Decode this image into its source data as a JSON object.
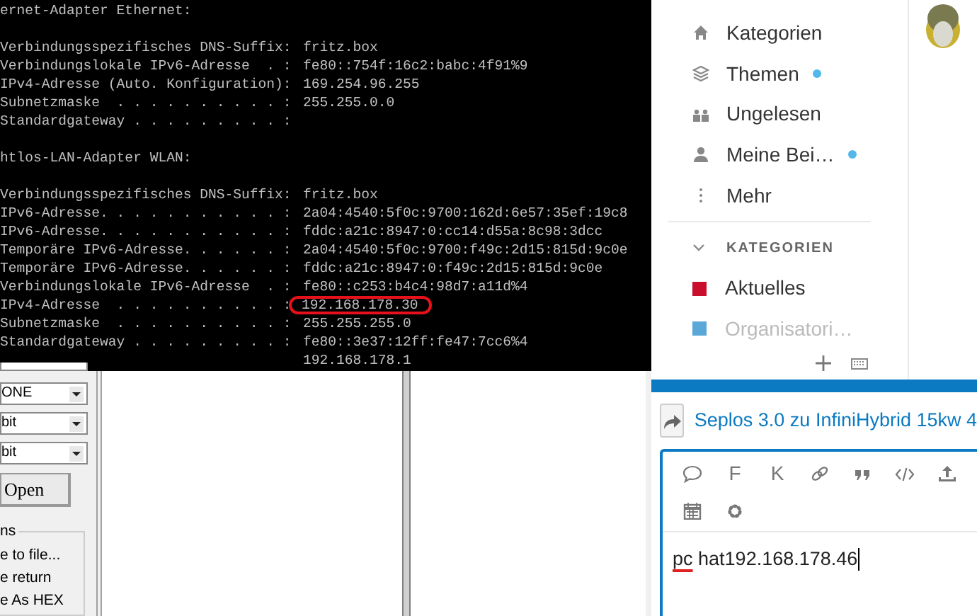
{
  "terminal": {
    "adapters": [
      {
        "title": "ernet-Adapter Ethernet:",
        "entries": [
          {
            "label": "Verbindungsspezifisches DNS-Suffix:",
            "value": "fritz.box",
            "highlighted": false
          },
          {
            "label": "Verbindungslokale IPv6-Adresse  . :",
            "value": "fe80::754f:16c2:babc:4f91%9",
            "highlighted": false
          },
          {
            "label": "IPv4-Adresse (Auto. Konfiguration):",
            "value": "169.254.96.255",
            "highlighted": false
          },
          {
            "label": "Subnetzmaske  . . . . . . . . . . :",
            "value": "255.255.0.0",
            "highlighted": false
          },
          {
            "label": "Standardgateway . . . . . . . . . :"
          }
        ]
      },
      {
        "title": "htlos-LAN-Adapter WLAN:",
        "entries": [
          {
            "label": "Verbindungsspezifisches DNS-Suffix:",
            "value": "fritz.box",
            "highlighted": false
          },
          {
            "label": "IPv6-Adresse. . . . . . . . . . . :",
            "value": "2a04:4540:5f0c:9700:162d:6e57:35ef:19c8",
            "highlighted": false
          },
          {
            "label": "IPv6-Adresse. . . . . . . . . . . :",
            "value": "fddc:a21c:8947:0:cc14:d55a:8c98:3dcc",
            "highlighted": false
          },
          {
            "label": "Temporäre IPv6-Adresse. . . . . . :",
            "value": "2a04:4540:5f0c:9700:f49c:2d15:815d:9c0e",
            "highlighted": false
          },
          {
            "label": "Temporäre IPv6-Adresse. . . . . . :",
            "value": "fddc:a21c:8947:0:f49c:2d15:815d:9c0e",
            "highlighted": false
          },
          {
            "label": "Verbindungslokale IPv6-Adresse  . :",
            "value": "fe80::c253:b4c4:98d7:a11d%4",
            "highlighted": false
          },
          {
            "label": "IPv4-Adresse  . . . . . . . . . . :",
            "value": "192.168.178.30",
            "highlighted": true
          },
          {
            "label": "Subnetzmaske  . . . . . . . . . . :",
            "value": "255.255.255.0",
            "highlighted": false
          },
          {
            "label": "Standardgateway . . . . . . . . . :",
            "value": "fe80::3e37:12ff:fe47:7cc6%4",
            "highlighted": false
          },
          {
            "value": "192.168.178.1",
            "highlighted": false
          }
        ]
      }
    ]
  },
  "sidebar": {
    "items": [
      {
        "label": "Kategorien",
        "unread": false
      },
      {
        "label": "Themen",
        "unread": true
      },
      {
        "label": "Ungelesen",
        "unread": false
      },
      {
        "label": "Meine Bei…",
        "unread": true
      },
      {
        "label": "Mehr",
        "unread": false
      }
    ],
    "categories": {
      "heading": "KATEGORIEN",
      "expanded": true,
      "items": [
        {
          "label": "Aktuelles",
          "color": "#c8102e",
          "faded": false
        },
        {
          "label": "Organisatori…",
          "color": "#5aa8d8",
          "faded": true
        }
      ]
    }
  },
  "serial_tool": {
    "dropdowns": [
      "ONE",
      "bit",
      "bit"
    ],
    "open_button": "Open",
    "group": {
      "title": "ns",
      "items": [
        "e to file...",
        "e return",
        "e As HEX"
      ]
    }
  },
  "composer": {
    "topic": "Seplos 3.0 zu InfiniHybrid 15kw 4",
    "toolbar": [
      {
        "kind": "icon"
      },
      {
        "kind": "text",
        "label": "F"
      },
      {
        "kind": "text",
        "label": "K"
      },
      {
        "kind": "icon"
      },
      {
        "kind": "icon"
      },
      {
        "kind": "icon"
      },
      {
        "kind": "icon"
      },
      {
        "kind": "icon"
      },
      {
        "kind": "icon"
      }
    ],
    "text": [
      {
        "word": "pc",
        "misspelled": true
      },
      {
        "word": "hat192.168.178.46",
        "misspelled": false
      }
    ]
  }
}
